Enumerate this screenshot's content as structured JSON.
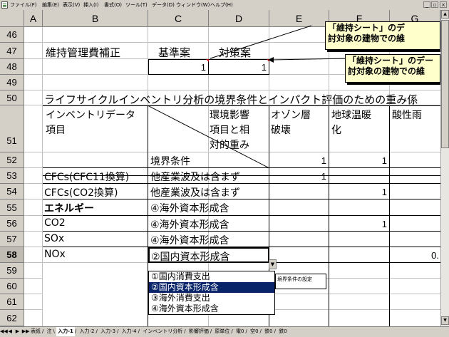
{
  "menu": {
    "items": [
      "ファイル(F)",
      "編集(E)",
      "表示(V)",
      "挿入(I)",
      "書式(O)",
      "ツール(T)",
      "データ(D)",
      "ウィンドウ(W)",
      "ヘルプ(H)"
    ],
    "ctl_min": "_",
    "ctl_restore": "▫",
    "ctl_close": "×"
  },
  "columns": [
    "A",
    "B",
    "C",
    "D",
    "E",
    "F",
    "G"
  ],
  "rows": [
    "46",
    "47",
    "48",
    "49",
    "50",
    "51",
    "52",
    "53",
    "54",
    "55",
    "56",
    "57",
    "58",
    "59",
    "60",
    "61",
    "62"
  ],
  "selected_row": "58",
  "cells": {
    "b47": "維持管理費補正",
    "c47": "基準案",
    "d47": "対策案",
    "c48": "1",
    "d48": "1",
    "title50": "ライフサイクルインベントリ分析の境界条件とインパクト評価のための重み係",
    "b51_line1": "インベントリデータ",
    "b51_line2": "項目",
    "c51_line1": "環境影響",
    "c51_line2": "項目と相",
    "c51_line3": "対的重み",
    "e51_line1": "オゾン層",
    "e51_line2": "破壊",
    "f51_line1": "地球温暖",
    "f51_line2": "化",
    "g51": "酸性雨",
    "c52": "境界条件",
    "e52": "1",
    "f52": "1",
    "b53": "CFCs(CFC11換算)",
    "c53": "他産業波及は含まず",
    "e53": "1",
    "b54": "CFCs(CO2換算)",
    "c54": "他産業波及は含まず",
    "f54": "1",
    "b55": "エネルギー",
    "c55": "④海外資本形成含",
    "b56": "CO2",
    "c56": "④海外資本形成含",
    "f56": "1",
    "b57": "SOx",
    "c57": "④海外資本形成含",
    "b58": "NOx",
    "c58": "②国内資本形成含",
    "g58": "0."
  },
  "callouts": [
    {
      "line1": "「維持シート」のデ",
      "line2": "討対象の建物での維"
    },
    {
      "line1": "「維持シート」のデー",
      "line2": "討対象の建物での維"
    }
  ],
  "dropdown": {
    "options": [
      "①国内消費支出",
      "②国内資本形成含",
      "③海外消費支出",
      "④海外資本形成含"
    ],
    "selected_index": 1,
    "arrow": "▼"
  },
  "popup_text": "境界条件の設定",
  "sheet_tabs": {
    "nav": [
      "◀◀",
      "◀",
      "▶",
      "▶▶"
    ],
    "tabs": [
      "表紙",
      "注",
      "入力-1",
      "入力-2",
      "入力-3",
      "入力-4",
      "インベントリ分析",
      "影響評価",
      "原単位",
      "電0",
      "空0",
      "鉄0",
      "鉄0"
    ],
    "active_index": 2
  },
  "scroll_arrows": {
    "up": "▲",
    "down": "▼"
  }
}
